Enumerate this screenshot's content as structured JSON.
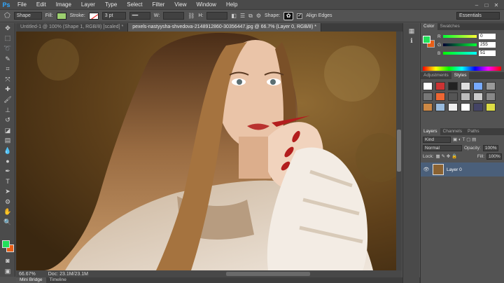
{
  "menu": [
    "Ps",
    "File",
    "Edit",
    "Image",
    "Layer",
    "Type",
    "Select",
    "Filter",
    "View",
    "Window",
    "Help"
  ],
  "options": {
    "mode": "Shape",
    "fill_label": "Fill:",
    "stroke_label": "Stroke:",
    "stroke_width": "3 pt",
    "w_label": "W:",
    "h_label": "H:",
    "shape_label": "Shape:",
    "align_edges": "Align Edges",
    "workspace": "Essentials"
  },
  "tabs": [
    {
      "label": "Untitled-1 @ 100% (Shape 1, RGB/8) [scaled] *",
      "active": false
    },
    {
      "label": "pexels-nastyysha-shvedova-2148912860-30356447.jpg @ 66.7% (Layer 0, RGB/8) *",
      "active": true
    }
  ],
  "status": {
    "zoom": "66.67%",
    "doc": "Doc: 23.1M/23.1M"
  },
  "bottom_tabs": [
    "Mini Bridge",
    "Timeline"
  ],
  "color_panel": {
    "tabs": [
      "Color",
      "Swatches"
    ],
    "channels": [
      {
        "ch": "R",
        "value": "0"
      },
      {
        "ch": "G",
        "value": "255"
      },
      {
        "ch": "B",
        "value": "51"
      }
    ],
    "fg": "#22e05a",
    "bg": "#e85e16"
  },
  "styles_panel": {
    "tabs": [
      "Adjustments",
      "Styles"
    ]
  },
  "layers_panel": {
    "tabs": [
      "Layers",
      "Channels",
      "Paths"
    ],
    "filter": "Kind",
    "blend": "Normal",
    "opacity_label": "Opacity:",
    "opacity": "100%",
    "lock_label": "Lock:",
    "fill_label": "Fill:",
    "fill": "100%",
    "layers": [
      {
        "name": "Layer 0"
      }
    ]
  }
}
